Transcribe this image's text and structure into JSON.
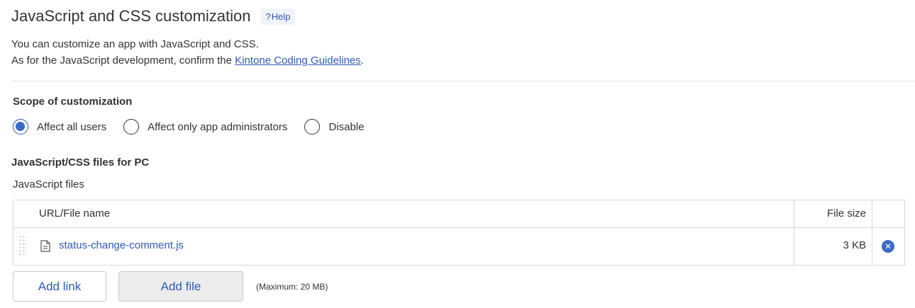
{
  "header": {
    "title": "JavaScript and CSS customization",
    "help_label": "Help",
    "help_icon": "?"
  },
  "description": {
    "line1": "You can customize an app with JavaScript and CSS.",
    "line2_prefix": "As for the JavaScript development, confirm the ",
    "link_text": "Kintone Coding Guidelines",
    "line2_suffix": "."
  },
  "scope": {
    "heading": "Scope of customization",
    "options": [
      {
        "label": "Affect all users",
        "checked": true
      },
      {
        "label": "Affect only app administrators",
        "checked": false
      },
      {
        "label": "Disable",
        "checked": false
      }
    ]
  },
  "pc_files": {
    "heading": "JavaScript/CSS files for PC",
    "js_label": "JavaScript files",
    "columns": {
      "name": "URL/File name",
      "size": "File size"
    },
    "rows": [
      {
        "name": "status-change-comment.js",
        "size": "3 KB",
        "icon": "file-icon"
      }
    ],
    "add_link_label": "Add link",
    "add_file_label": "Add file",
    "max_note": "(Maximum: 20 MB)"
  },
  "colors": {
    "accent": "#3b6ac9",
    "link": "#2e5bb5",
    "divider": "#e3e3e3"
  }
}
